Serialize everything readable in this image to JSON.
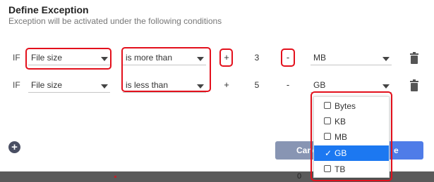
{
  "header": {
    "title": "Define Exception",
    "subtitle": "Exception will be activated under the following conditions"
  },
  "rows": [
    {
      "prefix": "IF",
      "field": "File size",
      "operator": "is more than",
      "plus": "+",
      "value": "3",
      "minus": "-",
      "unit": "MB"
    },
    {
      "prefix": "IF",
      "field": "File size",
      "operator": "is less than",
      "plus": "+",
      "value": "5",
      "minus": "-",
      "unit": "GB"
    }
  ],
  "unit_dropdown": {
    "options": [
      "Bytes",
      "KB",
      "MB",
      "GB",
      "TB"
    ],
    "selected": "GB",
    "check_mark": "✓"
  },
  "actions": {
    "add_symbol": "+",
    "cancel_label": "Cancel",
    "primary_label_fragment": "e"
  },
  "footer": {
    "value": "0"
  },
  "colors": {
    "highlight": "#e3101c",
    "selected_bg": "#1c78f1",
    "primary": "#4f7ce8",
    "cancel": "#8895b3"
  }
}
